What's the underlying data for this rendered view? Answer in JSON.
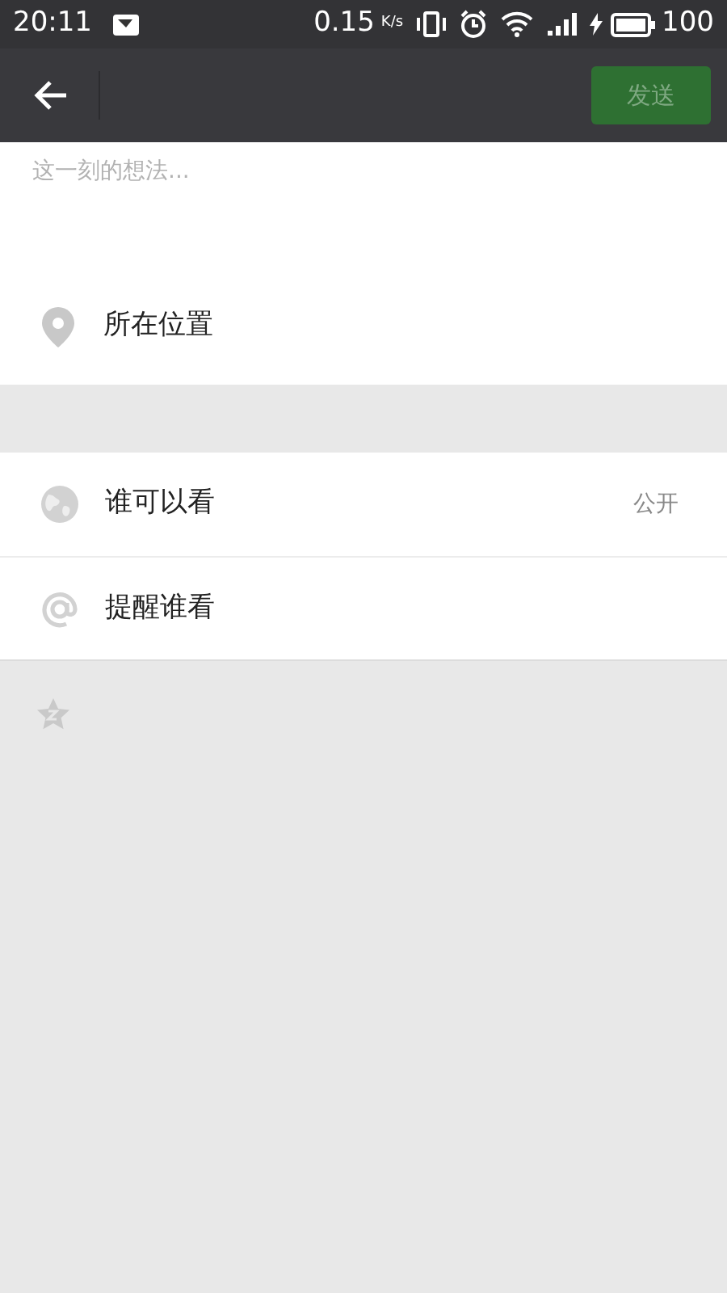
{
  "status_bar": {
    "time": "20:11",
    "speed": "0.15",
    "speed_unit": "K/s",
    "battery": "100"
  },
  "toolbar": {
    "send_button": {
      "label": "发送",
      "disabled": true
    }
  },
  "composer": {
    "placeholder": "这一刻的想法..."
  },
  "location": {
    "label": "所在位置"
  },
  "options": [
    {
      "kind": "visibility",
      "label": "谁可以看",
      "value": "公开"
    },
    {
      "kind": "mention",
      "label": "提醒谁看"
    }
  ]
}
